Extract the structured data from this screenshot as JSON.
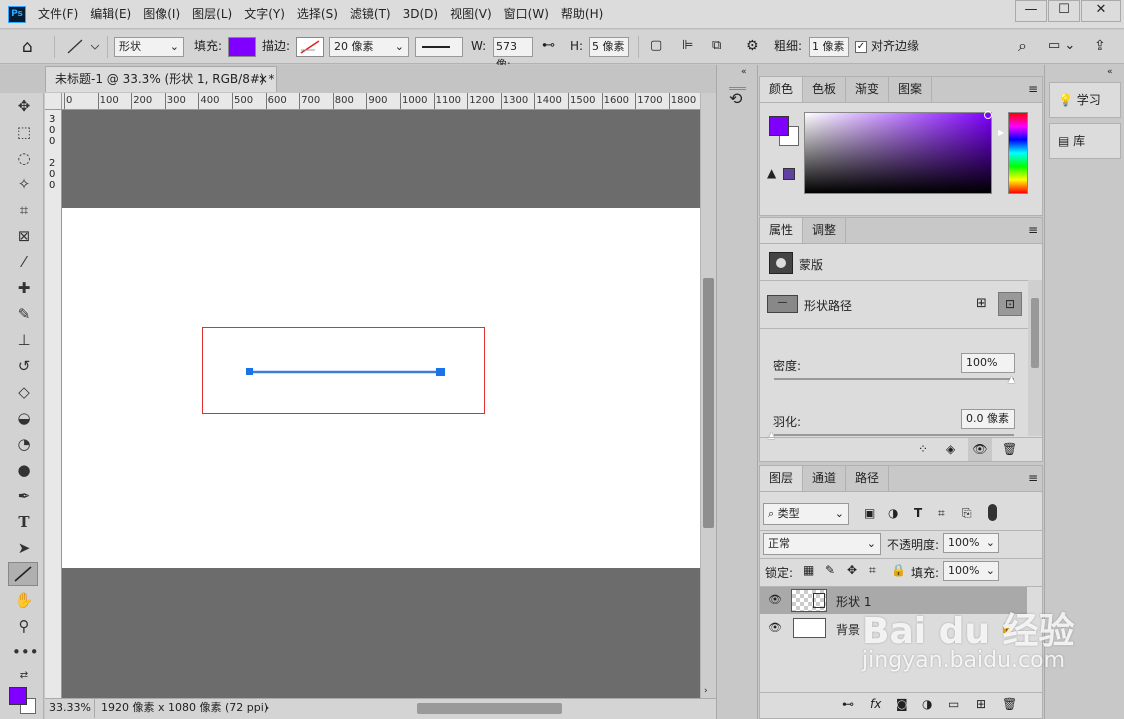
{
  "app": {
    "menus": [
      "文件(F)",
      "编辑(E)",
      "图像(I)",
      "图层(L)",
      "文字(Y)",
      "选择(S)",
      "滤镜(T)",
      "3D(D)",
      "视图(V)",
      "窗口(W)",
      "帮助(H)"
    ],
    "logo": "Ps"
  },
  "options_bar": {
    "mode": "形状",
    "fill_label": "填充:",
    "stroke_label": "描边:",
    "stroke_width": "20 像素",
    "w_label": "W:",
    "w_value": "573 像:",
    "h_label": "H:",
    "h_value": "5 像素",
    "weight_label": "粗细:",
    "weight_value": "1 像素",
    "align_edges_label": "对齐边缘",
    "fill_color": "#7f00ff"
  },
  "document": {
    "tab_title": "未标题-1 @ 33.3% (形状 1, RGB/8#) *",
    "ruler_labels": [
      "0",
      "100",
      "200",
      "300",
      "400",
      "500",
      "600",
      "700",
      "800",
      "900",
      "1000",
      "1100",
      "1200",
      "1300",
      "1400",
      "1500",
      "1600",
      "1700",
      "1800"
    ],
    "zoom": "33.33%",
    "doc_info": "1920 像素 x 1080 像素 (72 ppi)"
  },
  "color_panel": {
    "tabs": [
      "颜色",
      "色板",
      "渐变",
      "图案"
    ],
    "foreground": "#7f00ff",
    "background": "#ffffff"
  },
  "properties_panel": {
    "tabs": [
      "属性",
      "调整"
    ],
    "mask_label": "蒙版",
    "shape_path_label": "形状路径",
    "density_label": "密度:",
    "density_value": "100%",
    "feather_label": "羽化:",
    "feather_value": "0.0 像素"
  },
  "layers_panel": {
    "tabs": [
      "图层",
      "通道",
      "路径"
    ],
    "filter_kind": "类型",
    "blend_mode": "正常",
    "opacity_label": "不透明度:",
    "opacity_value": "100%",
    "lock_label": "锁定:",
    "fill_label": "填充:",
    "fill_value": "100%",
    "layers": [
      {
        "name": "形状 1"
      },
      {
        "name": "背景"
      }
    ]
  },
  "right_dock": {
    "learn": "学习",
    "library": "库"
  },
  "watermark": {
    "brand": "Bai du 经验",
    "url": "jingyan.baidu.com"
  }
}
